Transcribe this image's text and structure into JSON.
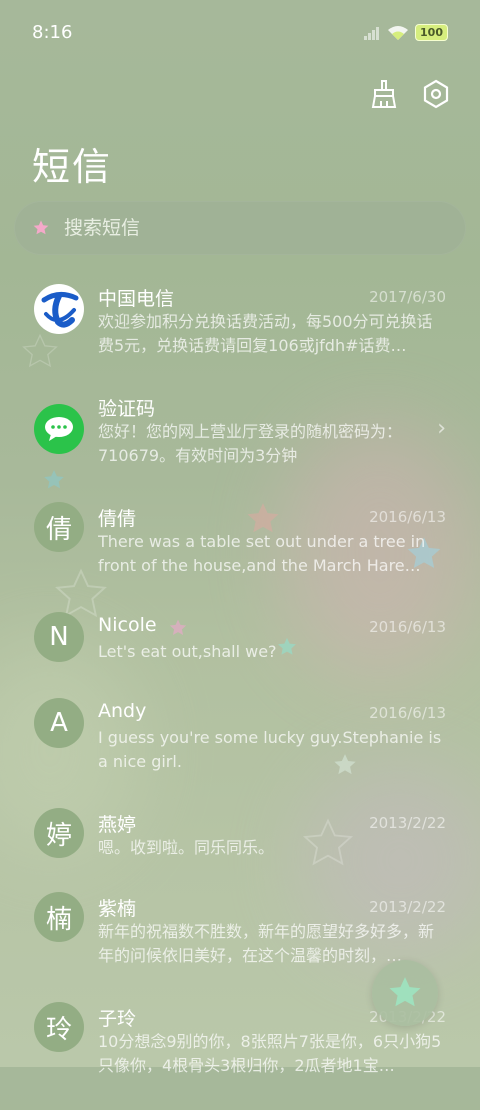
{
  "status_bar": {
    "time": "8:16",
    "battery": "100"
  },
  "page": {
    "title": "短信"
  },
  "search": {
    "placeholder": "搜索短信"
  },
  "icons": {
    "clean": "broom-icon",
    "settings": "settings-hex-icon",
    "search": "star-icon",
    "fab": "star-icon"
  },
  "colors": {
    "background": "#a6b89a",
    "avatar": "#93ad84",
    "battery": "#d6ee7e",
    "search_star": "#f4a9c9",
    "fab_star": "#9fe0bd"
  },
  "messages": [
    {
      "name": "中国电信",
      "date": "2017/6/30",
      "preview": "欢迎参加积分兑换话费活动，每500分可兑换话费5元，兑换话费请回复106或jfdh#话费…",
      "avatar_text": "",
      "avatar_type": "telecom-logo"
    },
    {
      "name": "验证码",
      "date": "",
      "preview": "您好！您的网上营业厅登录的随机密码为：710679。有效时间为3分钟",
      "avatar_text": "",
      "avatar_type": "chat-bubble"
    },
    {
      "name": "倩倩",
      "date": "2016/6/13",
      "preview": "There was a table set out under a tree in front of the house,and the March Hare an…",
      "avatar_text": "倩"
    },
    {
      "name": "Nicole",
      "date": "2016/6/13",
      "preview": "Let's eat out,shall we?",
      "avatar_text": "N"
    },
    {
      "name": "Andy",
      "date": "2016/6/13",
      "preview": "I guess you're some lucky guy.Stephanie is a nice girl.",
      "avatar_text": "A"
    },
    {
      "name": "燕婷",
      "date": "2013/2/22",
      "preview": "嗯。收到啦。同乐同乐。",
      "avatar_text": "婷"
    },
    {
      "name": "紫楠",
      "date": "2013/2/22",
      "preview": "新年的祝福数不胜数，新年的愿望好多好多，新年的问候依旧美好，在这个温馨的时刻，…",
      "avatar_text": "楠"
    },
    {
      "name": "子玲",
      "date": "2013/2/22",
      "preview": "10分想念9别的你，8张照片7张是你，6只小狗5只像你，4根骨头3根归你，2瓜者地1宝…",
      "avatar_text": "玲"
    }
  ]
}
